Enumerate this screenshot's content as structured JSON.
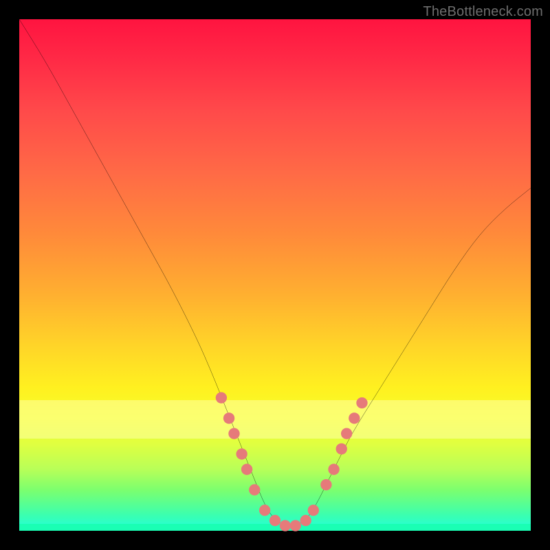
{
  "watermark": "TheBottleneck.com",
  "colors": {
    "frame_bg": "#000000",
    "curve_stroke": "#000000",
    "dot_fill": "#e67a7a",
    "gradient_top": "#ff1440",
    "gradient_bottom": "#20ffe0"
  },
  "chart_data": {
    "type": "line",
    "title": "",
    "xlabel": "",
    "ylabel": "",
    "xlim": [
      0,
      100
    ],
    "ylim": [
      0,
      100
    ],
    "grid": false,
    "legend": false,
    "note": "No axis ticks or labels are visible; x and y are normalized 0–100. y=0 at bottom (green), y=100 at top (red). Curve is V-shaped with minimum near x≈48–55.",
    "series": [
      {
        "name": "bottleneck-curve",
        "x": [
          0,
          5,
          10,
          15,
          20,
          25,
          30,
          35,
          38,
          40,
          42,
          44,
          46,
          48,
          50,
          52,
          54,
          56,
          58,
          60,
          62,
          65,
          70,
          75,
          80,
          85,
          90,
          95,
          100
        ],
        "y": [
          100,
          92,
          83,
          74,
          65,
          56,
          47,
          37,
          30,
          25,
          20,
          15,
          10,
          5,
          2,
          1,
          1,
          2,
          5,
          9,
          13,
          19,
          27,
          35,
          43,
          51,
          58,
          63,
          67
        ]
      }
    ],
    "markers": {
      "name": "highlight-dots",
      "note": "Salmon-colored dots/pill segments along the curve near the trough and lower flanks.",
      "points": [
        {
          "x": 39.5,
          "y": 26
        },
        {
          "x": 41.0,
          "y": 22
        },
        {
          "x": 42.0,
          "y": 19
        },
        {
          "x": 43.5,
          "y": 15
        },
        {
          "x": 44.5,
          "y": 12
        },
        {
          "x": 46.0,
          "y": 8
        },
        {
          "x": 48.0,
          "y": 4
        },
        {
          "x": 50.0,
          "y": 2
        },
        {
          "x": 52.0,
          "y": 1
        },
        {
          "x": 54.0,
          "y": 1
        },
        {
          "x": 56.0,
          "y": 2
        },
        {
          "x": 57.5,
          "y": 4
        },
        {
          "x": 60.0,
          "y": 9
        },
        {
          "x": 61.5,
          "y": 12
        },
        {
          "x": 63.0,
          "y": 16
        },
        {
          "x": 64.0,
          "y": 19
        },
        {
          "x": 65.5,
          "y": 22
        },
        {
          "x": 67.0,
          "y": 25
        }
      ]
    }
  }
}
